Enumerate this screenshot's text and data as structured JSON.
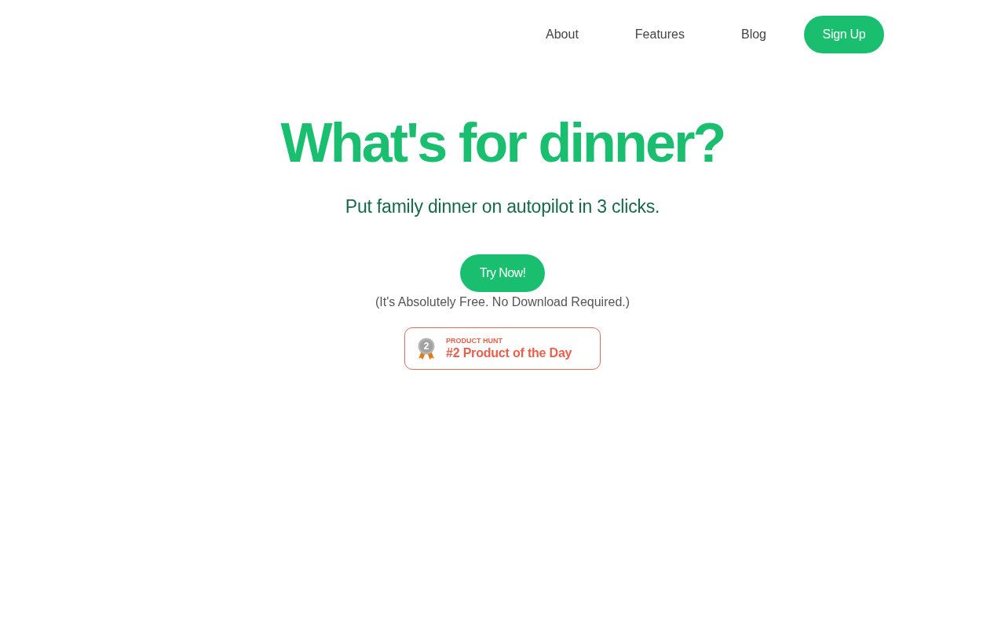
{
  "nav": {
    "links": [
      {
        "label": "About"
      },
      {
        "label": "Features"
      },
      {
        "label": "Blog"
      }
    ],
    "signup": {
      "label": "Sign Up"
    }
  },
  "hero": {
    "title": "What's for dinner?",
    "subtitle": "Put family dinner on autopilot in 3 clicks.",
    "cta": {
      "label": "Try Now!"
    },
    "note": "(It's Absolutely Free. No Download Required.)"
  },
  "badge": {
    "medal_number": "2",
    "kicker": "PRODUCT HUNT",
    "text": "#2 Product of the Day"
  }
}
